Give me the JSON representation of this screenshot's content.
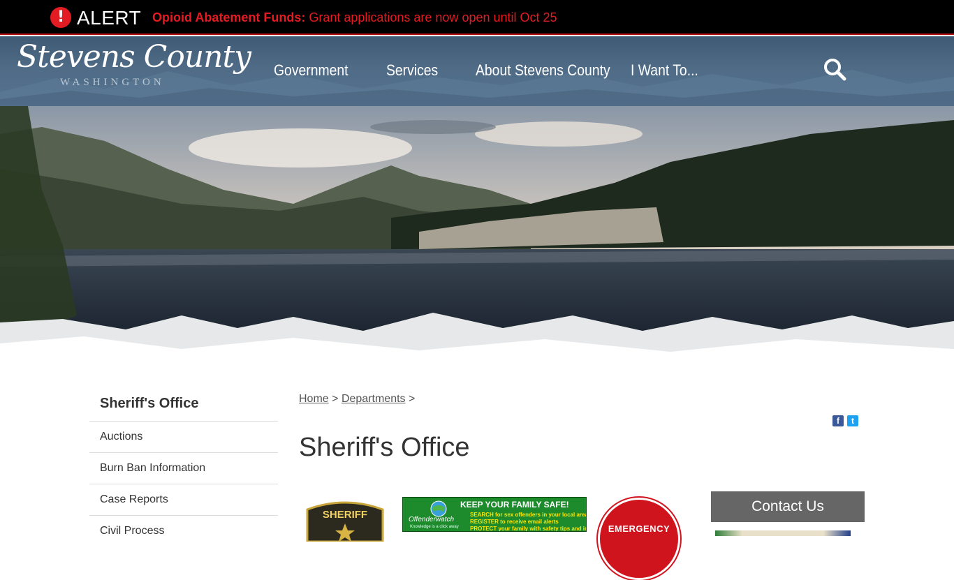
{
  "alert": {
    "word": "ALERT",
    "icon": "exclamation-icon",
    "title": "Opioid Abatement Funds:",
    "message": " Grant applications are now open until Oct 25"
  },
  "logo": {
    "script": "Stevens County",
    "sub": "WASHINGTON"
  },
  "nav": {
    "items": [
      "Government",
      "Services",
      "About Stevens County",
      "I Want To..."
    ],
    "search_icon": "search-icon"
  },
  "sidebar": {
    "title": "Sheriff's Office",
    "items": [
      "Auctions",
      "Burn Ban Information",
      "Case Reports",
      "Civil Process"
    ]
  },
  "breadcrumb": {
    "home": "Home",
    "sep1": ">",
    "departments": "Departments",
    "sep2": ">"
  },
  "social": {
    "facebook": "f",
    "twitter": "t"
  },
  "page": {
    "title": "Sheriff's Office"
  },
  "badge": {
    "text": "SHERIFF"
  },
  "offenderwatch": {
    "headline": "KEEP YOUR FAMILY SAFE!",
    "line1": "SEARCH for sex offenders in your local area",
    "line2": "REGISTER to receive email alerts",
    "line3": "PROTECT your family with safety tips and information",
    "brand": "Offenderwatch",
    "tagline": "Knowledge is a click away"
  },
  "emergency": {
    "text": "EMERGENCY"
  },
  "contact": {
    "label": "Contact Us"
  },
  "colors": {
    "alert_red": "#e31b23",
    "header_blue": "#4f6b86",
    "contact_gray": "#666666"
  }
}
